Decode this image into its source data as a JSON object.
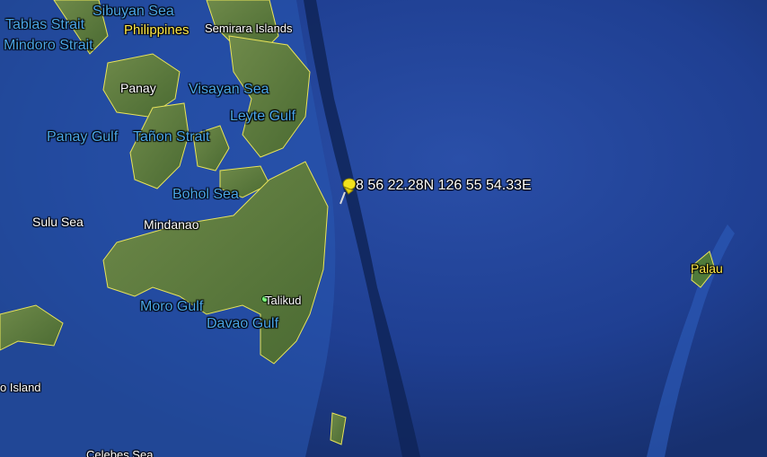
{
  "map": {
    "labels": {
      "tablas_strait": "Tablas Strait",
      "sibuyan_sea": "Sibuyan Sea",
      "mindoro_strait": "Mindoro Strait",
      "philippines": "Philippines",
      "semirara_islands": "Semirara Islands",
      "panay": "Panay",
      "visayan_sea": "Visayan Sea",
      "leyte_gulf": "Leyte Gulf",
      "panay_gulf": "Panay Gulf",
      "tanon_strait": "Tañon Strait",
      "bohol_sea": "Bohol Sea",
      "sulu_sea": "Sulu Sea",
      "mindanao": "Mindanao",
      "palau": "Palau",
      "talikud": "Talikud",
      "moro_gulf": "Moro Gulf",
      "davao_gulf": "Davao Gulf",
      "island_partial": "o Island",
      "celebes_sea": "Celebes Sea"
    },
    "placemark": {
      "label": "8 56 22.28N 126 55 54.33E",
      "icon": "yellow-pushpin-icon",
      "color": "#f2e21c"
    },
    "colors": {
      "ocean": "#1f3f8f",
      "land": "#5d7a3c",
      "coastline": "#e8e35a",
      "sea_label": "#4aa6e8",
      "country_label": "#ffe94a"
    }
  }
}
